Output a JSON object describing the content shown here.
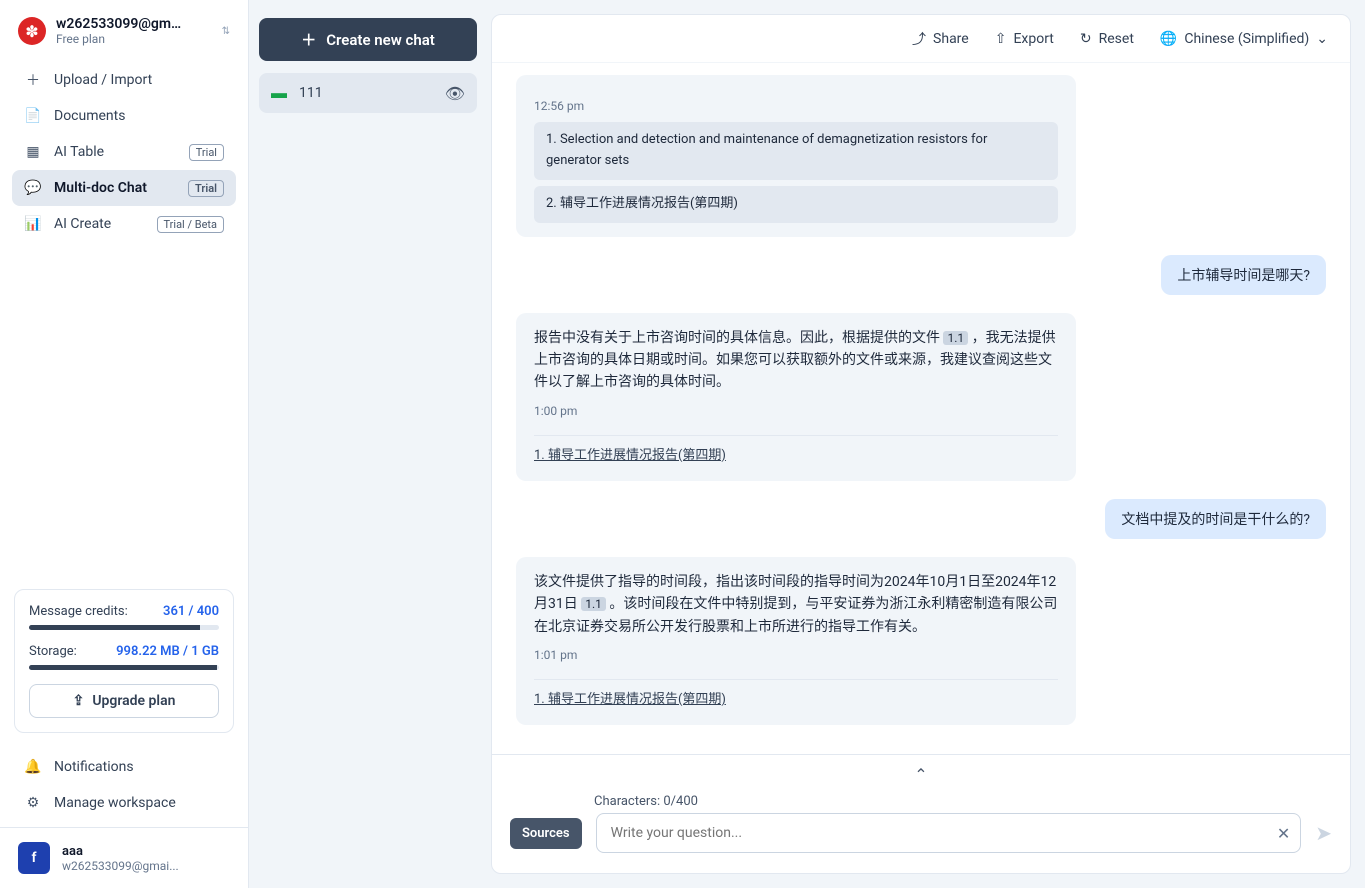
{
  "sidebar": {
    "email_trunc": "w262533099@gm…",
    "plan": "Free plan",
    "nav": [
      {
        "icon": "upload",
        "label": "Upload / Import",
        "badge": null
      },
      {
        "icon": "docs",
        "label": "Documents",
        "badge": null
      },
      {
        "icon": "table",
        "label": "AI Table",
        "badge": "Trial"
      },
      {
        "icon": "chat",
        "label": "Multi-doc Chat",
        "badge": "Trial",
        "active": true
      },
      {
        "icon": "create",
        "label": "AI Create",
        "badge": "Trial / Beta"
      }
    ],
    "usage": {
      "credits_label": "Message credits:",
      "credits_value": "361 / 400",
      "credits_pct": 90,
      "storage_label": "Storage:",
      "storage_value": "998.22 MB / 1 GB",
      "storage_pct": 99
    },
    "upgrade_label": "Upgrade plan",
    "bottom_nav": [
      {
        "icon": "bell",
        "label": "Notifications"
      },
      {
        "icon": "gear",
        "label": "Manage workspace"
      }
    ],
    "user": {
      "avatar": "f",
      "name": "aaa",
      "email": "w262533099@gmai..."
    }
  },
  "chatlist": {
    "new_label": "Create new chat",
    "items": [
      {
        "title": "111"
      }
    ]
  },
  "topbar": {
    "share": "Share",
    "export": "Export",
    "reset": "Reset",
    "language": "Chinese (Simplified)"
  },
  "messages": [
    {
      "role": "ai",
      "time": "12:56 pm",
      "docs": [
        "1. Selection and detection and maintenance of demagnetization resistors for generator sets",
        "2. 辅导工作进展情况报告(第四期)"
      ]
    },
    {
      "role": "user",
      "text": "上市辅导时间是哪天?"
    },
    {
      "role": "ai",
      "text_pre": "报告中没有关于上市咨询时间的具体信息。因此，根据提供的文件 ",
      "ref": "1.1",
      "text_post": " ，我无法提供上市咨询的具体日期或时间。如果您可以获取额外的文件或来源，我建议查阅这些文件以了解上市咨询的具体时间。",
      "time": "1:00 pm",
      "source": "1. 辅导工作进展情况报告(第四期)"
    },
    {
      "role": "user",
      "text": "文档中提及的时间是干什么的?"
    },
    {
      "role": "ai",
      "text_pre": "该文件提供了指导的时间段，指出该时间段的指导时间为2024年10月1日至2024年12月31日 ",
      "ref": "1.1",
      "text_post": " 。该时间段在文件中特别提到，与平安证券为浙江永利精密制造有限公司在北京证券交易所公开发行股票和上市所进行的指导工作有关。",
      "time": "1:01 pm",
      "source": "1. 辅导工作进展情况报告(第四期)"
    }
  ],
  "composer": {
    "char_label": "Characters: 0/400",
    "sources_label": "Sources",
    "placeholder": "Write your question..."
  }
}
